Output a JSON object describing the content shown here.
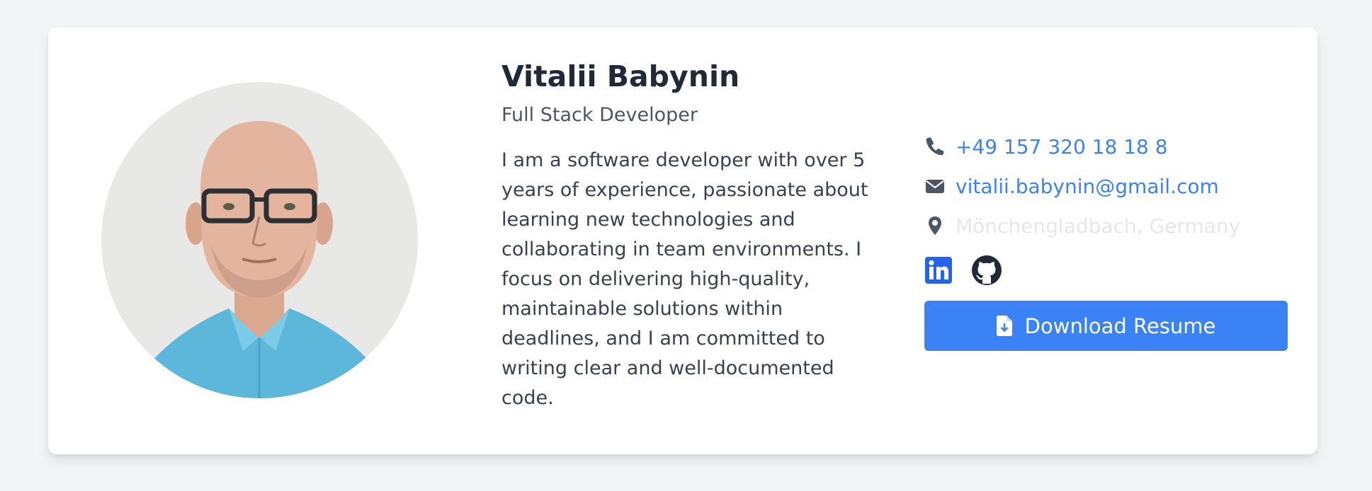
{
  "profile": {
    "name": "Vitalii Babynin",
    "title": "Full Stack Developer",
    "bio": "I am a software developer with over 5 years of experience, passionate about learning new technologies and collaborating in team environments. I focus on delivering high-quality, maintainable solutions within deadlines, and I am committed to writing clear and well-documented code."
  },
  "contact": {
    "phone": "+49 157 320 18 18 8",
    "email": "vitalii.babynin@gmail.com",
    "location": "Mönchengladbach, Germany"
  },
  "social": {
    "icons": [
      "linkedin-icon",
      "github-icon"
    ]
  },
  "actions": {
    "download_label": "Download Resume"
  },
  "colors": {
    "accent": "#3b82f6",
    "heading": "#1f2937",
    "linkedin": "#2563eb",
    "github": "#1f2937"
  }
}
